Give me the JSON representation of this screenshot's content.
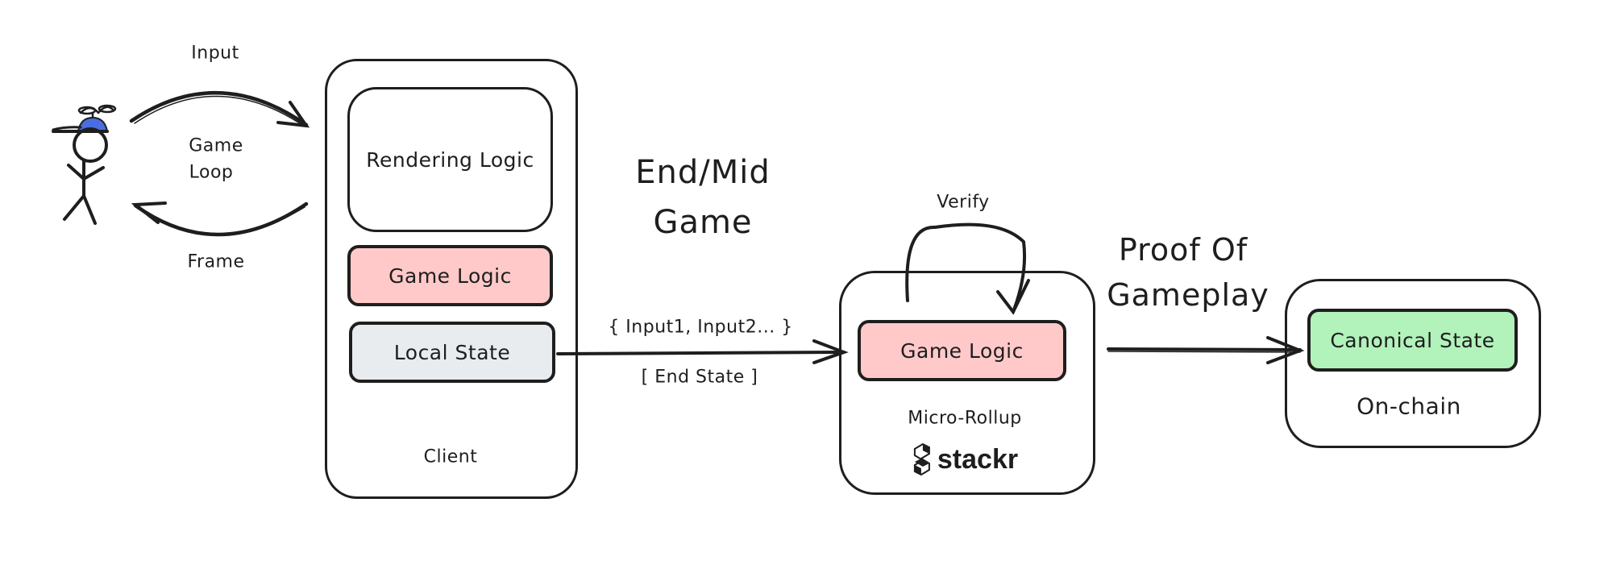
{
  "diagram": {
    "player": {
      "icon": "stick-figure-with-propeller-cap",
      "cap_color": "#4a6ee0"
    },
    "game_loop": {
      "label": "Game\nLoop",
      "label_line1": "Game",
      "label_line2": "Loop",
      "input_label": "Input",
      "frame_label": "Frame"
    },
    "client": {
      "label": "Client",
      "components": [
        {
          "label": "Rendering Logic",
          "fill": "#ffffff"
        },
        {
          "label": "Game Logic",
          "fill": "#ffc9c9"
        },
        {
          "label": "Local State",
          "fill": "#e9ecef"
        }
      ]
    },
    "transfer": {
      "title_line1": "End/Mid",
      "title_line2": "Game",
      "top_label": "{ Input1, Input2... }",
      "bottom_label": "[ End State ]"
    },
    "micro_rollup": {
      "label": "Micro-Rollup",
      "verify_label": "Verify",
      "component": {
        "label": "Game Logic",
        "fill": "#ffc9c9"
      },
      "brand": "stackr"
    },
    "proof": {
      "title_line1": "Proof Of",
      "title_line2": "Gameplay"
    },
    "on_chain": {
      "label": "On-chain",
      "component": {
        "label": "Canonical State",
        "fill": "#b2f2bb"
      }
    }
  }
}
